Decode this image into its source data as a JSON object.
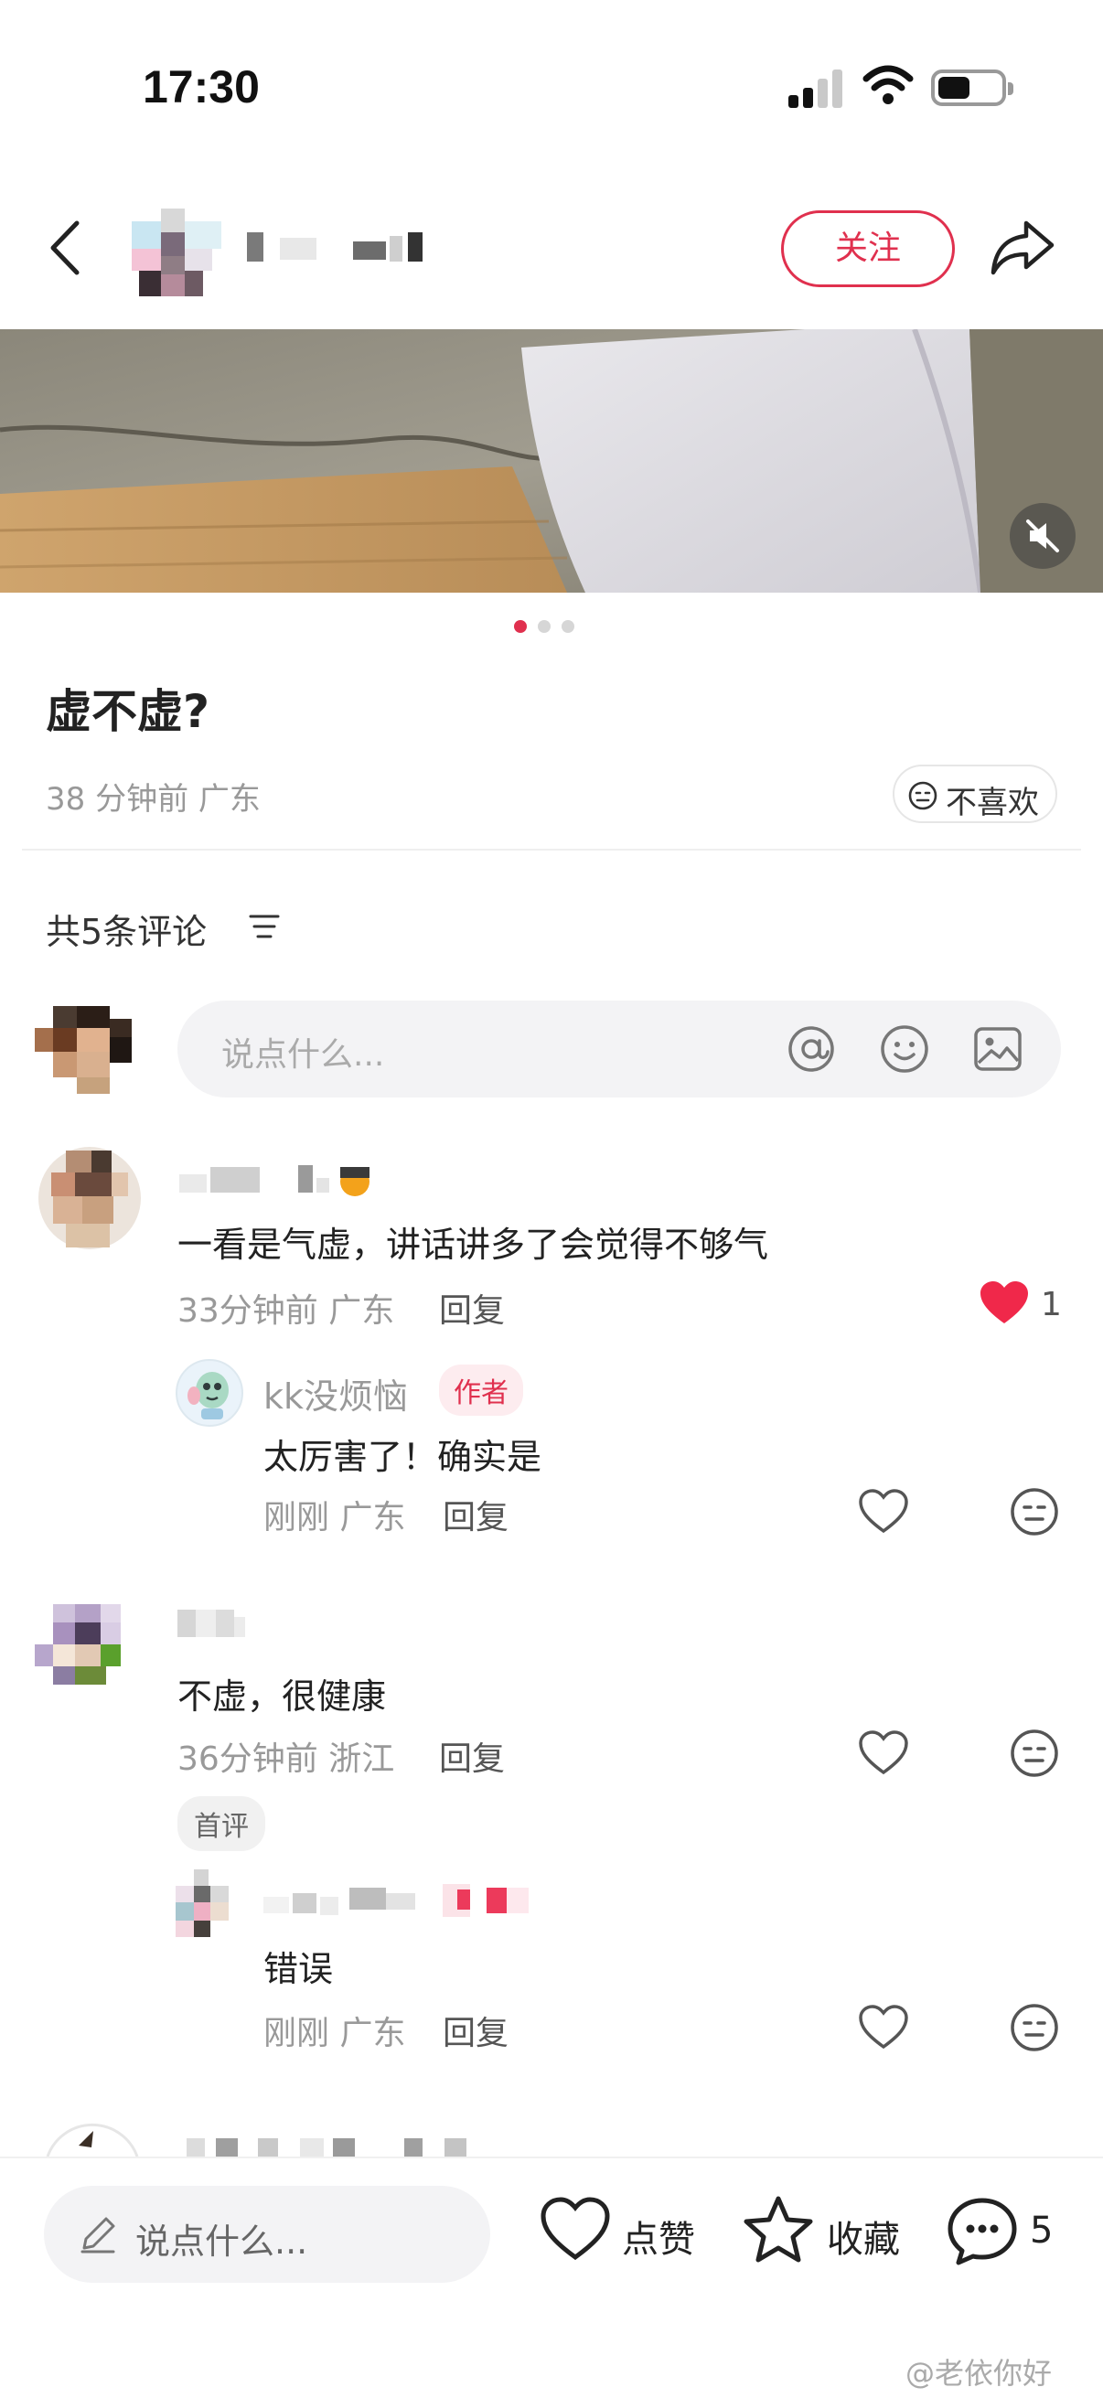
{
  "status_bar": {
    "time": "17:30"
  },
  "header": {
    "follow_label": "关注"
  },
  "post": {
    "title": "虚不虚?",
    "meta": "38 分钟前 广东",
    "dislike_label": "不喜欢",
    "image_count": 3,
    "current_image": 1
  },
  "comments_section": {
    "count_label": "共5条评论",
    "composer_placeholder": "说点什么..."
  },
  "comments": [
    {
      "text": "一看是气虚，讲话讲多了会觉得不够气",
      "meta": "33分钟前 广东",
      "reply_label": "回复",
      "likes": "1",
      "replies": [
        {
          "name": "kk没烦恼",
          "tag": "作者",
          "text": "太厉害了！确实是",
          "meta": "刚刚 广东",
          "reply_label": "回复"
        }
      ]
    },
    {
      "text": "不虚，很健康",
      "meta": "36分钟前 浙江",
      "reply_label": "回复",
      "tag": "首评",
      "replies": [
        {
          "text": "错误",
          "meta": "刚刚 广东",
          "reply_label": "回复"
        }
      ]
    }
  ],
  "bottom_bar": {
    "input_placeholder": "说点什么...",
    "like_label": "点赞",
    "collect_label": "收藏",
    "comment_count": "5"
  },
  "watermark": "@老依你好",
  "colors": {
    "accent": "#e0304e",
    "muted": "#999999"
  }
}
